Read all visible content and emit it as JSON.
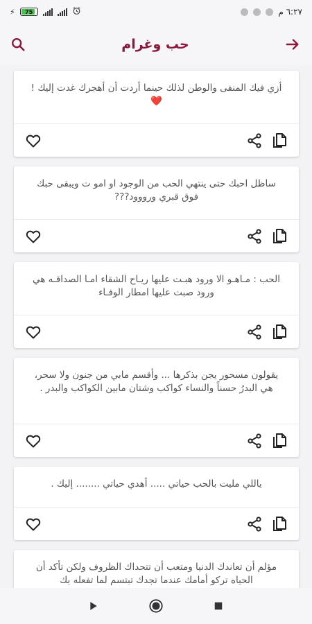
{
  "status_bar": {
    "time": "٦:٢٧ م",
    "battery_level": "75",
    "battery_fraction": 0.75,
    "charging_icon": "bolt-icon"
  },
  "app_bar": {
    "title": "حب وغرام",
    "back_icon": "arrow-icon",
    "search_icon": "search-icon"
  },
  "colors": {
    "accent": "#8b1a3a",
    "heart": "#e0282e",
    "background": "#f3f3f6"
  },
  "cards": [
    {
      "text": "أزي فيك المنفى والوطن لذلك حينما أردت أن أهجرك غدت إليك !",
      "emoji": "❤️"
    },
    {
      "text": "ساظل احبك حتى ينتهي الحب من الوجود او امو ت ويبقى حبك فوق قبري ورووود???",
      "emoji": ""
    },
    {
      "text": "الحب : مـاهـو الا ورود هبـت عليها ريـاح الشقاء امـا الصداقـه هي ورود صبت عليها امطار الوفـاء",
      "emoji": ""
    },
    {
      "text": "يقولون مسحور يجن بذكرها ... وأقسم مابي من جنون ولا سحر، هي البدرُ حسناً والنساء كواكب وشتان مابين الكواكب والبدر .",
      "emoji": ""
    },
    {
      "text": "ياللي مليت بالحب حياتي ..... أهدي حياتي ........ إليك .",
      "emoji": ""
    },
    {
      "text": "مؤلم أن تعاندك الدنيا ومتعب أن تتحداك الظروف ولكن تأكد أن الحياه تركو أمامك عندما تجدك تبتسم لما تفعله بك",
      "emoji": ""
    }
  ],
  "nav": {
    "back": "play-back-icon",
    "home": "home-circle-icon",
    "recents": "square-icon"
  }
}
